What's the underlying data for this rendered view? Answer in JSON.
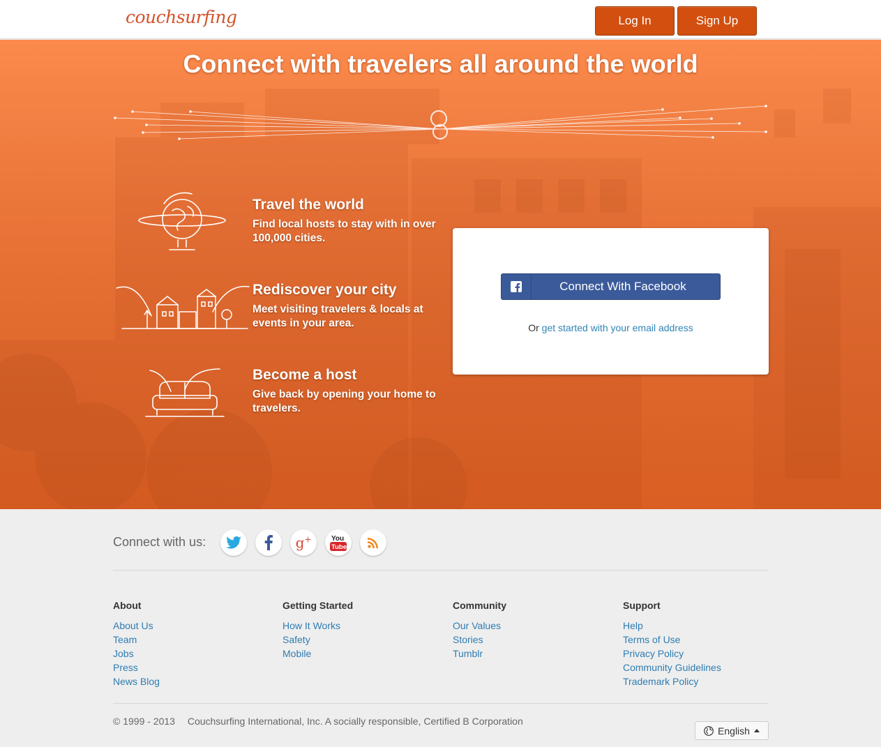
{
  "header": {
    "logo_text": "couchsurfing",
    "login_label": "Log In",
    "signup_label": "Sign Up"
  },
  "hero": {
    "title": "Connect with travelers all around the world",
    "features": [
      {
        "title": "Travel the world",
        "text": "Find local hosts to stay with in over 100,000 cities.",
        "icon": "globe-icon"
      },
      {
        "title": "Rediscover your city",
        "text": "Meet visiting travelers & locals at events in your area.",
        "icon": "city-icon"
      },
      {
        "title": "Become a host",
        "text": "Give back by opening your home to travelers.",
        "icon": "couch-icon"
      }
    ],
    "facebook_label": "Connect With Facebook",
    "or_text": "Or",
    "email_link": "get started with your email address"
  },
  "footer": {
    "connect_label": "Connect with us:",
    "social": [
      "twitter-icon",
      "facebook-icon",
      "google-plus-icon",
      "youtube-icon",
      "rss-icon"
    ],
    "columns": [
      {
        "heading": "About",
        "links": [
          "About Us",
          "Team",
          "Jobs",
          "Press",
          "News Blog"
        ]
      },
      {
        "heading": "Getting Started",
        "links": [
          "How It Works",
          "Safety",
          "Mobile"
        ]
      },
      {
        "heading": "Community",
        "links": [
          "Our Values",
          "Stories",
          "Tumblr"
        ]
      },
      {
        "heading": "Support",
        "links": [
          "Help",
          "Terms of Use",
          "Privacy Policy",
          "Community Guidelines",
          "Trademark Policy"
        ]
      }
    ],
    "copyright_years": "© 1999 - 2013",
    "copyright_text": "Couchsurfing International, Inc. A socially responsible, Certified B Corporation",
    "language": "English"
  },
  "colors": {
    "brand_orange": "#d24f0f",
    "hero_orange": "#f7793a",
    "facebook_blue": "#3b5a9a",
    "link_blue": "#2e7cb1"
  }
}
